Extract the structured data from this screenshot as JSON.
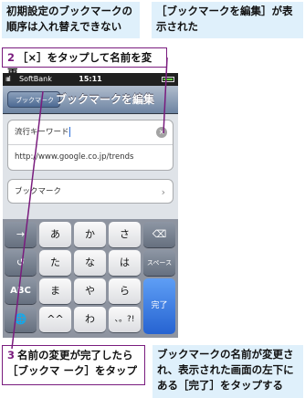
{
  "captions": {
    "top_left": "初期設定のブックマークの順序は入れ替えできない",
    "top_right": "［ブックマークを編集］が表示された",
    "bottom_right": "ブックマークの名前が変更され、表示された画面の左下にある［完了］をタップする"
  },
  "steps": {
    "step2": {
      "num": "2",
      "text": "［×］をタップして名前を変更"
    },
    "step3": {
      "num": "3",
      "text": "名前の変更が完了したら［ブックマ ーク］をタップ"
    }
  },
  "status_bar": {
    "signal": "ıııl",
    "carrier": "SoftBank",
    "time": "15:11"
  },
  "nav": {
    "back_label": "ブックマーク",
    "title": "ブックマークを編集"
  },
  "form": {
    "name_value": "流行キーワード",
    "url_value": "http://www.google.co.jp/trends",
    "folder_label": "ブックマーク",
    "clear_icon": "×",
    "chevron": "›"
  },
  "keyboard": {
    "row1": [
      "→",
      "あ",
      "か",
      "さ",
      "⌫"
    ],
    "row2": [
      "↺",
      "た",
      "な",
      "は",
      "スペース"
    ],
    "row3": [
      "ABC",
      "ま",
      "や",
      "ら"
    ],
    "row4": [
      "🌐",
      "^^",
      "わ",
      "、。?!"
    ],
    "done": "完了"
  },
  "colors": {
    "step_accent": "#7a1c7e",
    "callout_bg": "#dff0fb",
    "done_key": "#3a7fe3"
  }
}
